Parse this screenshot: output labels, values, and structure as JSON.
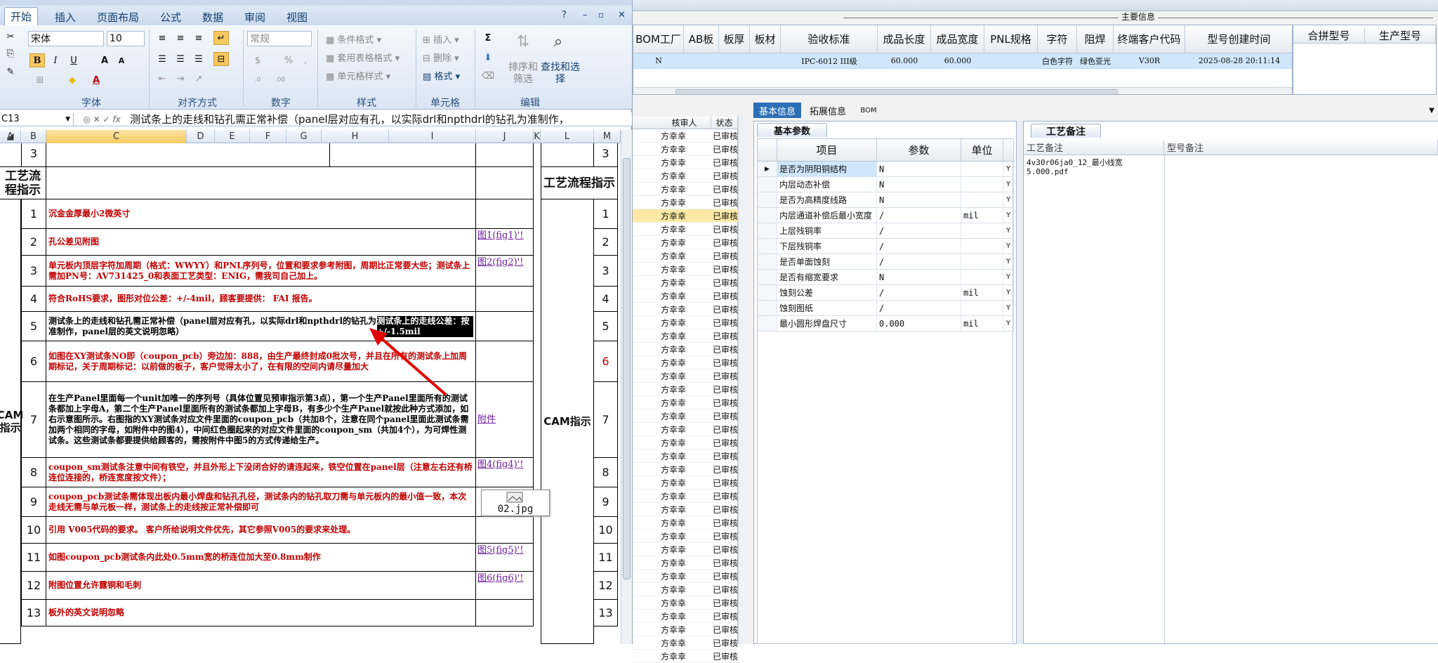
{
  "excel": {
    "tabs": [
      "开始",
      "插入",
      "页面布局",
      "公式",
      "数据",
      "审阅",
      "视图"
    ],
    "font_name": "宋体",
    "font_size": "10",
    "number_format": "常规",
    "groups": [
      "字体",
      "对齐方式",
      "数字",
      "样式",
      "单元格",
      "编辑"
    ],
    "style_btns": [
      "条件格式",
      "套用表格格式",
      "单元格样式"
    ],
    "cell_btns": [
      "插入",
      "删除",
      "格式"
    ],
    "edit_btns": [
      "排序和筛选",
      "查找和选择"
    ],
    "name_box": "C13",
    "formula": "测试条上的走线和钻孔需正常补偿（panel层对应有孔，以实际drl和npthdrl的钻孔为准制作，",
    "columns": [
      "A",
      "B",
      "C",
      "D",
      "E",
      "F",
      "G",
      "H",
      "I",
      "J",
      "K",
      "L",
      "M"
    ],
    "section_process": "工艺流程指示",
    "section_cam": "CAM指示",
    "rows": [
      {
        "n": "3",
        "text": ""
      },
      {
        "n": "1",
        "text": "沉金金厚最小2微英寸",
        "red": true
      },
      {
        "n": "2",
        "text": "孔公差见附图",
        "red": true,
        "link": "图1(fig1)'!"
      },
      {
        "n": "3",
        "text": "单元板内顶层字符加周期（格式：WWYY）和PNL序列号，位置和要求参考附图，周期比正常要大些；测试条上需加PN号：AV731425_0和表面工艺类型：ENIG，需我司自己加上。",
        "red": true,
        "link": "图2(fig2)'!"
      },
      {
        "n": "4",
        "text": "符合RoHS要求，图形对位公差：+/-4mil，顾客要提供： FAI 报告。",
        "red": true
      },
      {
        "n": "5",
        "text": "测试条上的走线和钻孔需正常补偿（panel层对应有孔，以实际drl和npthdrl的钻孔为准制作，panel层的英文说明忽略）",
        "hl": "测试条上的走线公差：按+/-1.5mil"
      },
      {
        "n": "6",
        "text": "如图在XY测试条NO即（coupon_pcb）旁边加：888，由生产最终封成0批次号，并且在所有的测试条上加周期标记，关于周期标记：以前做的板子，客户觉得太小了，在有限的空间内请尽量加大",
        "red": true
      },
      {
        "n": "7",
        "text": "在生产Panel里面每一个unit加唯一的序列号（具体位置见预审指示第3点），第一个生产Panel里面所有的测试条都加上字母A，第二个生产Panel里面所有的测试条都加上字母B，有多少个生产Panel就按此种方式添加，如右示意图所示。右图指的XY测试条对应文件里面的coupon_pcb（共加8个，注意在同个panel里面此测试条需加两个相同的字母，如附件中的图4），中间红色圈起来的对应文件里面的coupon_sm（共加4个），为可焊性测试条。这些测试条都要提供给顾客的，需按附件中图5的方式传递给生产。",
        "link": "附件"
      },
      {
        "n": "8",
        "text": "coupon_sm测试条注意中间有铁空，并且外形上下没闭合好的请连起来，铁空位置在panel层（注意左右还有桥连位连接的，桥连宽度按文件）；",
        "red": true,
        "link": "图4(fig4)'!"
      },
      {
        "n": "9",
        "text": "coupon_pcb测试条需体现出板内最小焊盘和钻孔孔径，测试条内的钻孔取刀需与单元板内的最小值一致，本次走线无需与单元板一样，测试条上的走线按正常补偿即可",
        "red": true
      },
      {
        "n": "10",
        "text": "引用 V005代码的要求。 客户所给说明文件优先，其它参照V005的要求来处理。",
        "red": true
      },
      {
        "n": "11",
        "text": "如图coupon_pcb测试条内此处0.5mm宽的桥连位加大至0.8mm制作",
        "red": true,
        "link": "图5(fig5)'!"
      },
      {
        "n": "12",
        "text": "附图位置允许露铜和毛刺",
        "red": true,
        "link": "图6(fig6)'!"
      },
      {
        "n": "13",
        "text": "板外的英文说明忽略",
        "red": true
      }
    ],
    "image_label": "02.jpg"
  },
  "right": {
    "main_info_title": "主要信息",
    "main_headers": [
      "BOM工厂",
      "AB板",
      "板厚",
      "板材",
      "验收标准",
      "成品长度",
      "成品宽度",
      "PNL规格",
      "字符",
      "阻焊",
      "终端客户代码",
      "型号创建时间"
    ],
    "main_row": [
      "N",
      "",
      "",
      "",
      "IPC-6012 III级",
      "60.000",
      "60.000",
      "",
      "白色字符",
      "绿色亚光",
      "V30R",
      "2025-08-28 20:11:14"
    ],
    "merge_headers": [
      "合拼型号",
      "生产型号"
    ],
    "tabs": [
      "基本信息",
      "拓展信息",
      "BOM"
    ],
    "reviewer_headers": [
      "核审人",
      "状态"
    ],
    "reviewer_name": "方幸幸",
    "reviewer_status": "已审核",
    "basic_tab": "基本参数",
    "param_headers": [
      "项目",
      "参数",
      "单位"
    ],
    "params": [
      {
        "item": "是否为阴阳铜结构",
        "val": "N",
        "unit": "",
        "y": "Y"
      },
      {
        "item": "内层动态补偿",
        "val": "N",
        "unit": "",
        "y": "Y"
      },
      {
        "item": "是否为高精度线路",
        "val": "N",
        "unit": "",
        "y": "Y"
      },
      {
        "item": "内层通道补偿后最小宽度",
        "val": "/",
        "unit": "mil",
        "y": "Y"
      },
      {
        "item": "上层残铜率",
        "val": "/",
        "unit": "",
        "y": "Y"
      },
      {
        "item": "下层残铜率",
        "val": "/",
        "unit": "",
        "y": "Y"
      },
      {
        "item": "是否单面蚀刻",
        "val": "/",
        "unit": "",
        "y": "Y"
      },
      {
        "item": "是否有缩宽要求",
        "val": "N",
        "unit": "",
        "y": "Y"
      },
      {
        "item": "蚀刻公差",
        "val": "/",
        "unit": "mil",
        "y": "Y"
      },
      {
        "item": "蚀刻图纸",
        "val": "/",
        "unit": "",
        "y": "Y"
      },
      {
        "item": "最小圆形焊盘尺寸",
        "val": "0.000",
        "unit": "mil",
        "y": "Y"
      }
    ],
    "remark_tab": "工艺备注",
    "remark_headers": [
      "工艺备注",
      "型号备注"
    ],
    "remark_text": "4v30r06ja0_12_最小线宽5.000.pdf"
  }
}
